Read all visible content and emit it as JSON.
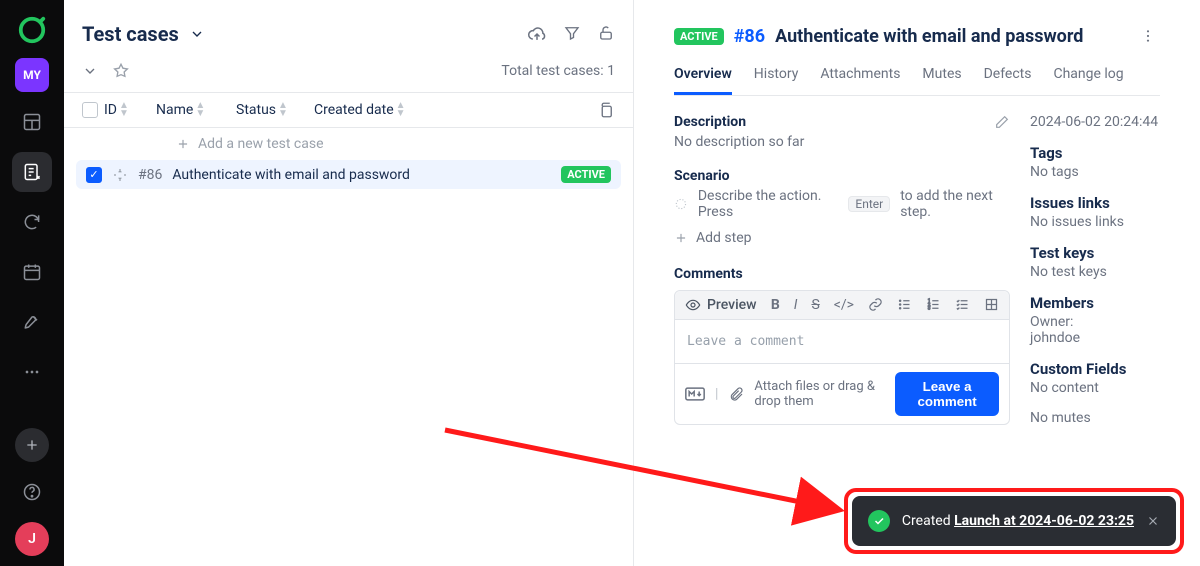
{
  "rail": {
    "project_badge": "MY",
    "avatar_letter": "J"
  },
  "left": {
    "title": "Test cases",
    "total_label": "Total test cases: 1",
    "columns": {
      "id": "ID",
      "name": "Name",
      "status": "Status",
      "created": "Created date"
    },
    "add_placeholder": "Add a new test case",
    "row": {
      "id": "#86",
      "title": "Authenticate with email and password",
      "status": "ACTIVE"
    }
  },
  "right": {
    "status": "ACTIVE",
    "id": "#86",
    "title": "Authenticate with email and password",
    "tabs": [
      "Overview",
      "History",
      "Attachments",
      "Mutes",
      "Defects",
      "Change log"
    ],
    "description_label": "Description",
    "description_value": "No description so far",
    "scenario_label": "Scenario",
    "scenario_hint_pre": "Describe the action. Press",
    "scenario_hint_key": "Enter",
    "scenario_hint_post": "to add the next step.",
    "add_step": "Add step",
    "comments_label": "Comments",
    "preview": "Preview",
    "comment_placeholder": "Leave a comment",
    "attach_text": "Attach files or drag & drop them",
    "leave_comment_btn": "Leave a comment"
  },
  "side": {
    "created_at": "2024-06-02 20:24:44",
    "tags_label": "Tags",
    "tags_value": "No tags",
    "issues_label": "Issues links",
    "issues_value": "No issues links",
    "testkeys_label": "Test keys",
    "testkeys_value": "No test keys",
    "members_label": "Members",
    "owner_label": "Owner:",
    "owner_value": "johndoe",
    "custom_label": "Custom Fields",
    "custom_value": "No content",
    "mutes_value": "No mutes"
  },
  "toast": {
    "prefix": "Created",
    "link": "Launch at 2024-06-02 23:25"
  }
}
